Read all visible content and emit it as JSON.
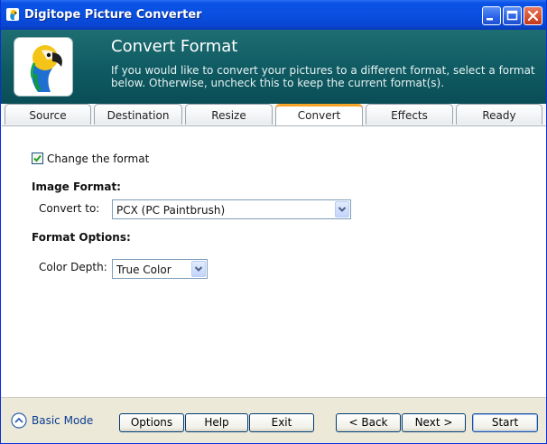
{
  "window": {
    "title": "Digitope Picture Converter"
  },
  "header": {
    "title": "Convert Format",
    "description": "If you would like to convert your pictures to a different format, select a format below.  Otherwise, uncheck this to keep the current format(s)."
  },
  "tabs": [
    {
      "label": "Source",
      "active": false
    },
    {
      "label": "Destination",
      "active": false
    },
    {
      "label": "Resize",
      "active": false
    },
    {
      "label": "Convert",
      "active": true
    },
    {
      "label": "Effects",
      "active": false
    },
    {
      "label": "Ready",
      "active": false
    }
  ],
  "content": {
    "change_format_label": "Change the format",
    "change_format_checked": true,
    "image_format_heading": "Image Format:",
    "convert_to_label": "Convert to:",
    "convert_to_value": "PCX (PC Paintbrush)",
    "format_options_heading": "Format Options:",
    "color_depth_label": "Color Depth:",
    "color_depth_value": "True Color"
  },
  "footer": {
    "basic_mode": "Basic Mode",
    "options": "Options",
    "help": "Help",
    "exit": "Exit",
    "back": "< Back",
    "next": "Next >",
    "start": "Start"
  },
  "colors": {
    "title_bar": "#0a4fe0",
    "header_band": "#0f5a62",
    "active_tab_accent": "#f7a32a",
    "checkmark": "#21a121"
  },
  "icons": {
    "app": "parrot-icon",
    "minimize": "minimize-icon",
    "maximize": "maximize-icon",
    "close": "close-icon",
    "checkbox": "checkmark-icon",
    "dropdown": "chevron-down-icon",
    "basic_mode": "chevron-up-circle-icon"
  }
}
